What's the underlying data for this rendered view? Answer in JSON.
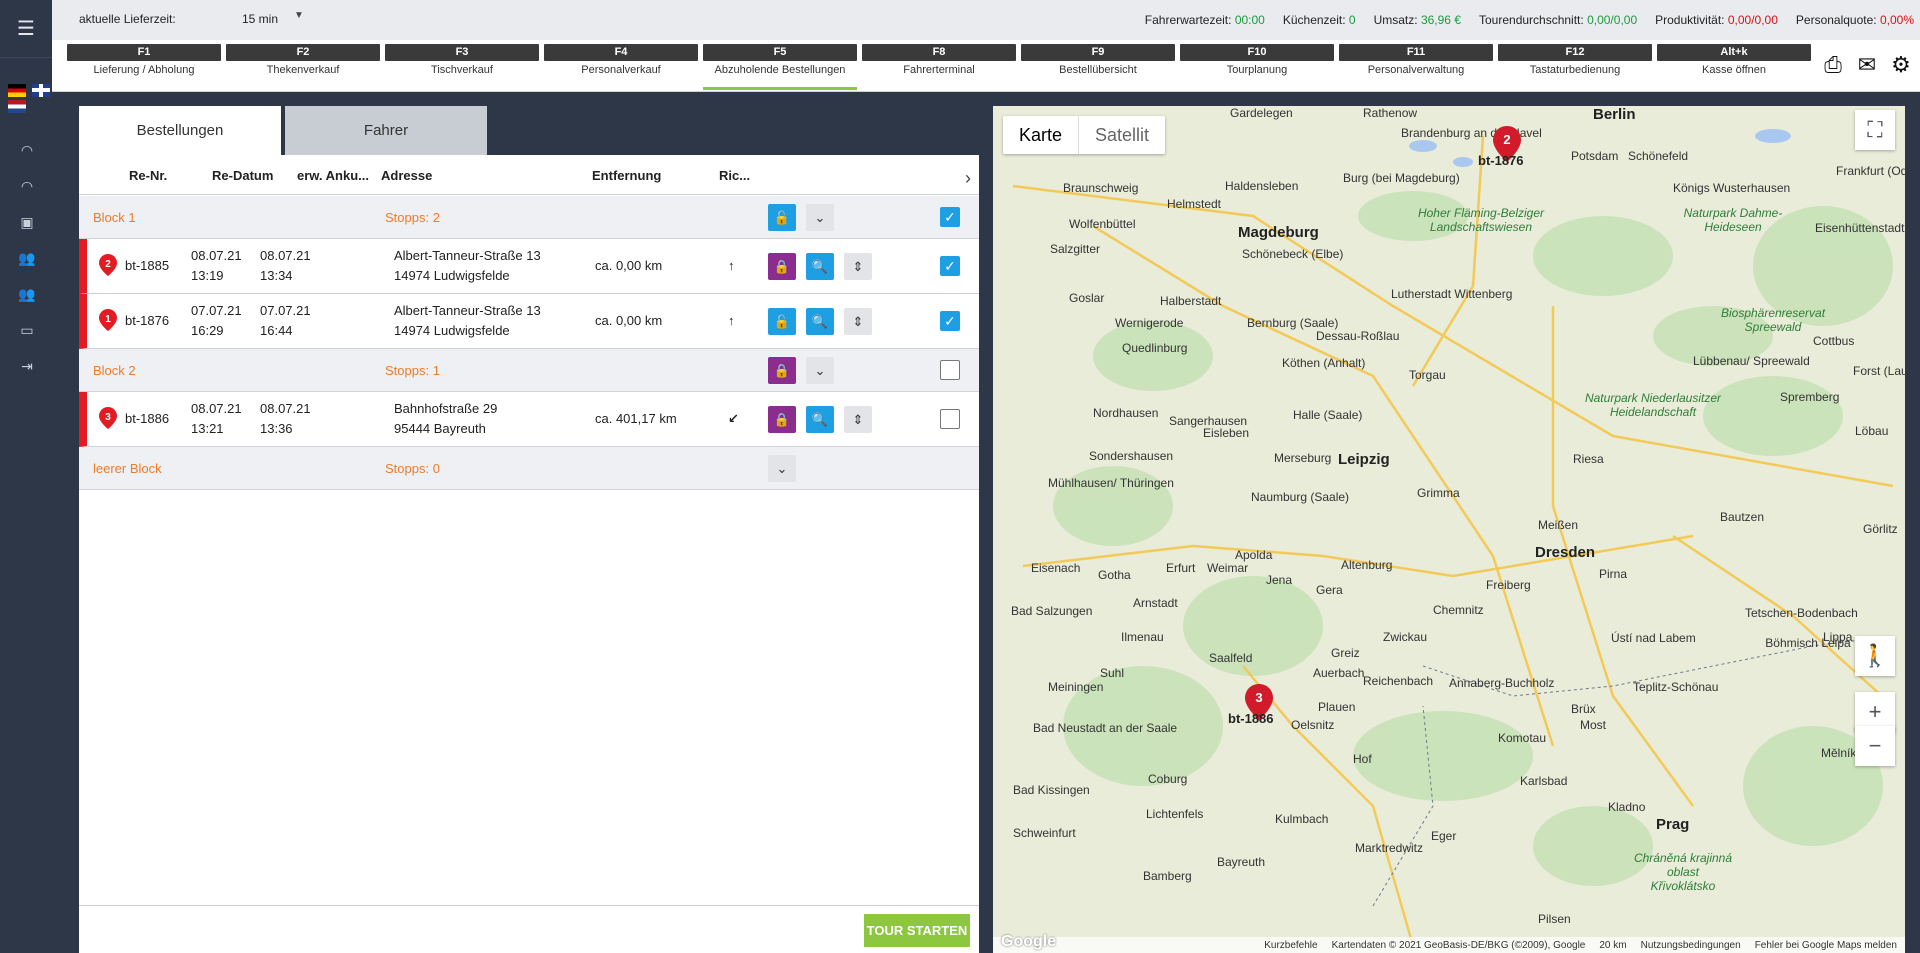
{
  "topbar": {
    "lieferzeit_label": "aktuelle Lieferzeit:",
    "lieferzeit_value": "15 min",
    "stats": [
      {
        "label": "Fahrerwartezeit:",
        "value": "00:00",
        "color": "#1a9b3d"
      },
      {
        "label": "Küchenzeit:",
        "value": "0",
        "color": "#1a9b3d"
      },
      {
        "label": "Umsatz:",
        "value": "36,96 €",
        "color": "#1a9b3d"
      },
      {
        "label": "Tourendurchschnitt:",
        "value": "0,00/0,00",
        "color": "#1a9b3d"
      },
      {
        "label": "Produktivität:",
        "value": "0,00/0,00",
        "color": "#dd1111"
      },
      {
        "label": "Personalquote:",
        "value": "0,00%",
        "color": "#dd1111"
      }
    ]
  },
  "fkeys": [
    {
      "key": "F1",
      "label": "Lieferung / Abholung"
    },
    {
      "key": "F2",
      "label": "Thekenverkauf"
    },
    {
      "key": "F3",
      "label": "Tischverkauf"
    },
    {
      "key": "F4",
      "label": "Personalverkauf"
    },
    {
      "key": "F5",
      "label": "Abzuholende Bestellungen"
    },
    {
      "key": "F8",
      "label": "Fahrerterminal"
    },
    {
      "key": "F9",
      "label": "Bestellübersicht"
    },
    {
      "key": "F10",
      "label": "Tourplanung"
    },
    {
      "key": "F11",
      "label": "Personalverwaltung"
    },
    {
      "key": "F12",
      "label": "Tastaturbedienung"
    },
    {
      "key": "Alt+k",
      "label": "Kasse öffnen"
    }
  ],
  "tabs": {
    "bestellungen": "Bestellungen",
    "fahrer": "Fahrer"
  },
  "table": {
    "headers": {
      "renr": "Re-Nr.",
      "redatum": "Re-Datum",
      "erw": "erw. Anku...",
      "adresse": "Adresse",
      "entfernung": "Entfernung",
      "richtung": "Ric..."
    },
    "blocks": [
      {
        "name": "Block 1",
        "stops": "Stopps: 2"
      },
      {
        "name": "Block 2",
        "stops": "Stopps: 1"
      },
      {
        "name": "leerer Block",
        "stops": "Stopps: 0"
      }
    ],
    "rows": [
      {
        "pin": "2",
        "renr": "bt-1885",
        "date1": "08.07.21",
        "time1": "13:19",
        "date2": "08.07.21",
        "time2": "13:34",
        "street": "Albert-Tanneur-Straße 13",
        "city": "14974 Ludwigsfelde",
        "dist": "ca. 0,00 km",
        "dir": "↑"
      },
      {
        "pin": "1",
        "renr": "bt-1876",
        "date1": "07.07.21",
        "time1": "16:29",
        "date2": "07.07.21",
        "time2": "16:44",
        "street": "Albert-Tanneur-Straße 13",
        "city": "14974 Ludwigsfelde",
        "dist": "ca. 0,00 km",
        "dir": "↑"
      },
      {
        "pin": "3",
        "renr": "bt-1886",
        "date1": "08.07.21",
        "time1": "13:21",
        "date2": "08.07.21",
        "time2": "13:36",
        "street": "Bahnhofstraße 29",
        "city": "95444 Bayreuth",
        "dist": "ca. 401,17 km",
        "dir": "↙"
      }
    ]
  },
  "tour_button": "TOUR STARTEN",
  "map": {
    "type_map": "Karte",
    "type_sat": "Satellit",
    "cities": [
      "Gardelegen",
      "Rathenow",
      "Berlin",
      "Brandenburg an der Havel",
      "Potsdam",
      "Schönefeld",
      "Frankfurt (Oder)",
      "Braunschweig",
      "Burg (bei Magdeburg)",
      "Haldensleben",
      "Wolfenbüttel",
      "Helmstedt",
      "Magdeburg",
      "Königs Wusterhausen",
      "Eisenhüttenstadt",
      "Salzgitter",
      "Schönebeck (Elbe)",
      "Goslar",
      "Halberstadt",
      "Lutherstadt Wittenberg",
      "Wernigerode",
      "Quedlinburg",
      "Bernburg (Saale)",
      "Dessau-Roßlau",
      "Cottbus",
      "Köthen (Anhalt)",
      "Torgau",
      "Spremberg",
      "Nordhausen",
      "Sangerhausen",
      "Halle (Saale)",
      "Sondershausen",
      "Leipzig",
      "Merseburg",
      "Riesa",
      "Mühlhausen/ Thüringen",
      "Grimma",
      "Naumburg (Saale)",
      "Meißen",
      "Bautzen",
      "Dresden",
      "Eisenach",
      "Gotha",
      "Erfurt",
      "Weimar",
      "Jena",
      "Gera",
      "Altenburg",
      "Freiberg",
      "Pirna",
      "Bad Salzungen",
      "Chemnitz",
      "Ilmenau",
      "Zwickau",
      "Suhl",
      "Greiz",
      "Meiningen",
      "Plauen",
      "Annaberg-Buchholz",
      "Teplitz-Schönau",
      "Most",
      "Hof",
      "Coburg",
      "Bad Kissingen",
      "Lichtenfels",
      "Karlsbad",
      "Komotau",
      "Schweinfurt",
      "Kulmbach",
      "Marktredwitz",
      "Eger",
      "Kladno",
      "Prag",
      "Bamberg",
      "Bayreuth",
      "Pilsen",
      "Ústí nad Labem",
      "Mělník",
      "Tetschen-Bodenbach",
      "Lippa",
      "Görlitz",
      "Löbau",
      "Brüx",
      "Auerbach",
      "Lübbenau/ Spreewald",
      "Forst (Lausitz)",
      "Oelsnitz",
      "Eisleben",
      "Bad Neustadt an der Saale",
      "Saalfeld",
      "Apolda",
      "Reichenbach",
      "Arnstadt"
    ],
    "regions": [
      "Hoher Fläming-Belziger Landschaftswiesen",
      "Naturpark Dahme-Heideseen",
      "Biosphärenreservat Spreewald",
      "Naturpark Niederlausitzer Heidelandschaft",
      "Böhmisch Leipa",
      "Chráněná krajinná oblast Křivoklátsko"
    ],
    "markers": [
      {
        "num": "2",
        "label": "bt-1876"
      },
      {
        "num": "3",
        "label": "bt-1886"
      }
    ],
    "copyright": [
      "Kurzbefehle",
      "Kartendaten © 2021 GeoBasis-DE/BKG (©2009), Google",
      "20 km",
      "Nutzungsbedingungen",
      "Fehler bei Google Maps melden"
    ],
    "logo": "Google"
  }
}
